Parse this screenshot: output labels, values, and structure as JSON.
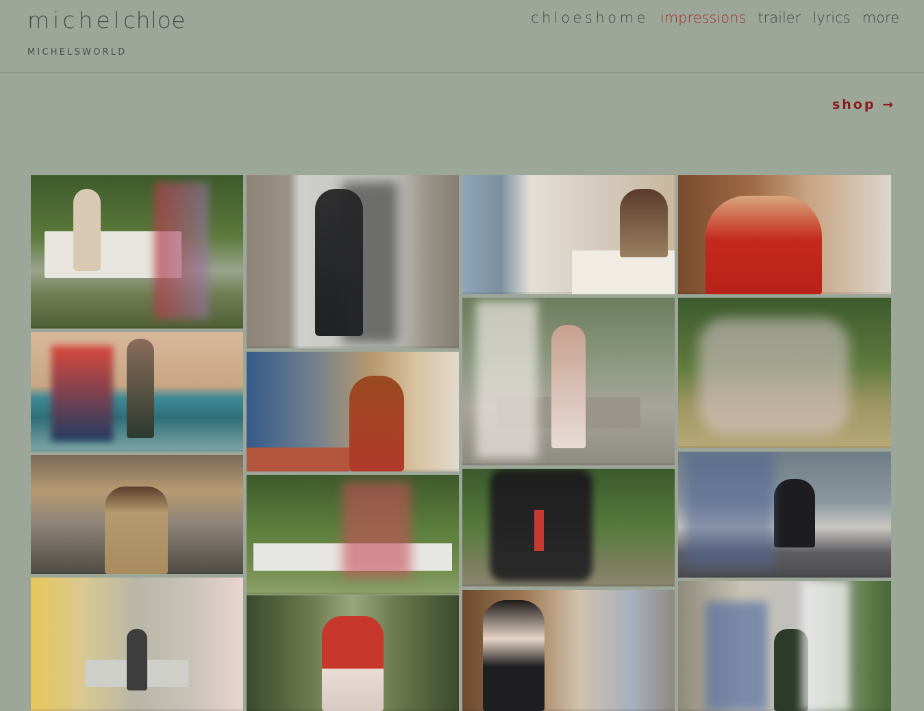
{
  "site": {
    "brand_first": "michel",
    "brand_last": "chloe",
    "tagline": "MICHELSWORLD"
  },
  "nav": {
    "items": [
      {
        "label": "chloeshome",
        "active": false
      },
      {
        "label": "impressions",
        "active": true
      },
      {
        "label": "trailer",
        "active": false
      },
      {
        "label": "lyrics",
        "active": false
      },
      {
        "label": "more",
        "active": false
      }
    ]
  },
  "shop": {
    "label": "shop →"
  },
  "colors": {
    "background": "#9ca699",
    "accent_red": "#a22d28",
    "shop_red": "#8b1c1c",
    "text": "#444444"
  },
  "gallery": {
    "watermark": "michelchloe"
  }
}
